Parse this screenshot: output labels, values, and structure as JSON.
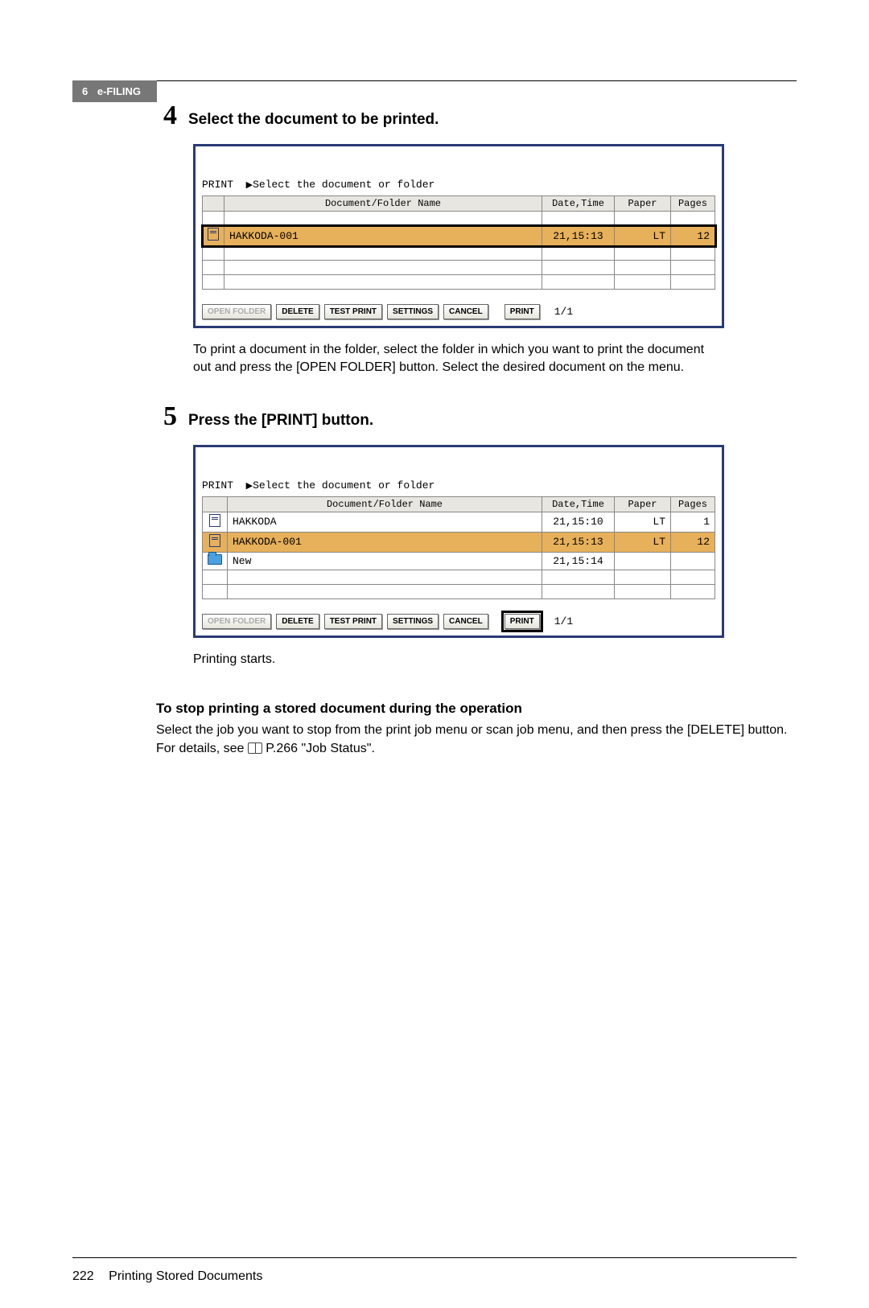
{
  "header": {
    "chapter_num": "6",
    "chapter_title": "e-FILING"
  },
  "step4": {
    "num": "4",
    "title": "Select the document to be printed.",
    "body": "To print a document in the folder, select the folder in which you want to print the document out and press the [OPEN FOLDER] button. Select the desired document on the menu."
  },
  "step5": {
    "num": "5",
    "title": "Press the [PRINT] button.",
    "body": "Printing starts."
  },
  "stop_section": {
    "heading": "To stop printing a stored document during the operation",
    "text_a": "Select the job you want to stop from the print job menu or scan job menu, and then press the [DELETE] button. For details, see ",
    "ref": "P.266 \"Job Status\"",
    "text_b": "."
  },
  "ui": {
    "print_label": "PRINT",
    "hint": "Select the document or folder",
    "cols": {
      "name": "Document/Folder Name",
      "date": "Date,Time",
      "paper": "Paper",
      "pages": "Pages"
    },
    "buttons": {
      "open_folder": "OPEN FOLDER",
      "delete": "DELETE",
      "test_print": "TEST PRINT",
      "settings": "SETTINGS",
      "cancel": "CANCEL",
      "print": "PRINT"
    },
    "page_counter": "1/1"
  },
  "screen1": {
    "rows": [
      {
        "type": "doc",
        "selected": true,
        "name": "HAKKODA-001",
        "date": "21,15:13",
        "paper": "LT",
        "pages": "12"
      }
    ]
  },
  "screen2": {
    "rows": [
      {
        "type": "doc",
        "selected": false,
        "name": "HAKKODA",
        "date": "21,15:10",
        "paper": "LT",
        "pages": "1"
      },
      {
        "type": "doc",
        "selected": true,
        "name": "HAKKODA-001",
        "date": "21,15:13",
        "paper": "LT",
        "pages": "12"
      },
      {
        "type": "folder",
        "selected": false,
        "name": "New",
        "date": "21,15:14",
        "paper": "",
        "pages": ""
      }
    ]
  },
  "footer": {
    "page_num": "222",
    "title": "Printing Stored Documents"
  }
}
